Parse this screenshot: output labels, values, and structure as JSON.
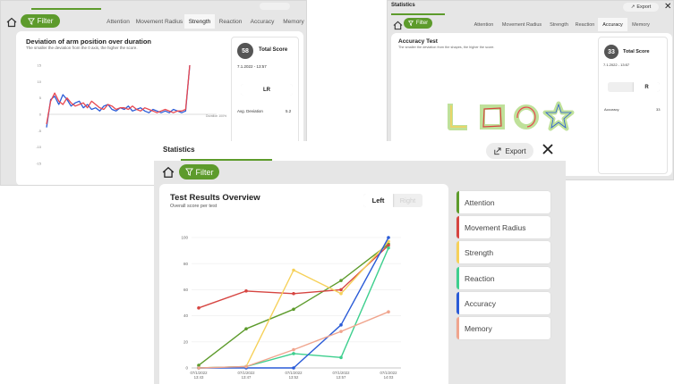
{
  "colors": {
    "accent": "#5d9b2c",
    "attention": "#5d9b2c",
    "movement_radius": "#d64541",
    "strength": "#f6d15a",
    "reaction": "#3ecf8e",
    "accuracy": "#2a5bd7",
    "memory": "#f0a58e",
    "secondary_line": "#e8474f"
  },
  "common": {
    "filter_label": "Filter",
    "export_label": "Export",
    "statistics_title": "Statistics"
  },
  "window1": {
    "tabs": [
      "Attention",
      "Movement Radius",
      "Strength",
      "Reaction",
      "Accuracy",
      "Memory"
    ],
    "active_tab": "Strength",
    "chart_title": "Deviation of arm position over duration",
    "chart_subtitle": "The smaller the deviation from the 0 axis, the higher the score.",
    "y_ticks": [
      "15",
      "10",
      "5",
      "0",
      "-5",
      "-10",
      "-15"
    ],
    "x_axis_label": "Duration 100%",
    "score": "58",
    "score_label": "Total Score",
    "datetime": "7.1.2022 - 13:57",
    "toggle_label": "LR",
    "stat_label": "Avg. Deviation",
    "stat_value": "5.2",
    "series": [
      {
        "values": [
          -4,
          4.5,
          5.5,
          3,
          6,
          4.5,
          2.5,
          3.5,
          4,
          2,
          3,
          1.5,
          2,
          1,
          2.5,
          3,
          1.5,
          1,
          2,
          1.5,
          2.5,
          1,
          1.5,
          2,
          1,
          0.5,
          1.5,
          1,
          0.5,
          1,
          0.5,
          1.5,
          1,
          0.5,
          1,
          15
        ]
      },
      {
        "values": [
          -3,
          4,
          6.5,
          4,
          3,
          5,
          3.5,
          2.5,
          3,
          3.5,
          2,
          4,
          3,
          2,
          1.5,
          3,
          2.5,
          1.5,
          2,
          2,
          1.5,
          2.5,
          1.5,
          1,
          2,
          1.5,
          1,
          0.5,
          1,
          1.5,
          1,
          0.5,
          1,
          1,
          1.5,
          15
        ]
      }
    ]
  },
  "window2": {
    "tabs": [
      "Attention",
      "Movement Radius",
      "Strength",
      "Reaction",
      "Accuracy",
      "Memory"
    ],
    "active_tab": "Accuracy",
    "chart_title": "Accuracy Test",
    "chart_subtitle": "The smaller the deviation from the shapes, the higher the score.",
    "score": "33",
    "score_label": "Total Score",
    "datetime": "7.1.2022 - 13:57",
    "toggle_label": "R",
    "stat_label": "Accuracy",
    "stat_value": "33"
  },
  "window3": {
    "chart_title": "Test Results Overview",
    "chart_subtitle": "Overall score per test",
    "toggle_left": "Left",
    "toggle_right": "Right",
    "legend": [
      "Attention",
      "Movement Radius",
      "Strength",
      "Reaction",
      "Accuracy",
      "Memory"
    ]
  },
  "chart_data": {
    "type": "line",
    "title": "Test Results Overview",
    "subtitle": "Overall score per test",
    "x": [
      "07/1/2022 13:43",
      "07/1/2022 13:47",
      "07/1/2022 13:52",
      "07/1/2022 13:57",
      "07/1/2022 14:03"
    ],
    "ylim": [
      0,
      100
    ],
    "y_ticks": [
      0,
      20,
      40,
      60,
      80,
      100
    ],
    "grid": true,
    "series": [
      {
        "name": "Attention",
        "values": [
          2,
          30,
          45,
          67,
          95
        ]
      },
      {
        "name": "Movement Radius",
        "values": [
          46,
          59,
          57,
          60,
          94
        ]
      },
      {
        "name": "Strength",
        "values": [
          0,
          1,
          75,
          57,
          97
        ]
      },
      {
        "name": "Reaction",
        "values": [
          0,
          1,
          11,
          8,
          92
        ]
      },
      {
        "name": "Accuracy",
        "values": [
          0,
          0,
          0,
          33,
          100
        ]
      },
      {
        "name": "Memory",
        "values": [
          0,
          1,
          14,
          28,
          43
        ]
      }
    ]
  }
}
